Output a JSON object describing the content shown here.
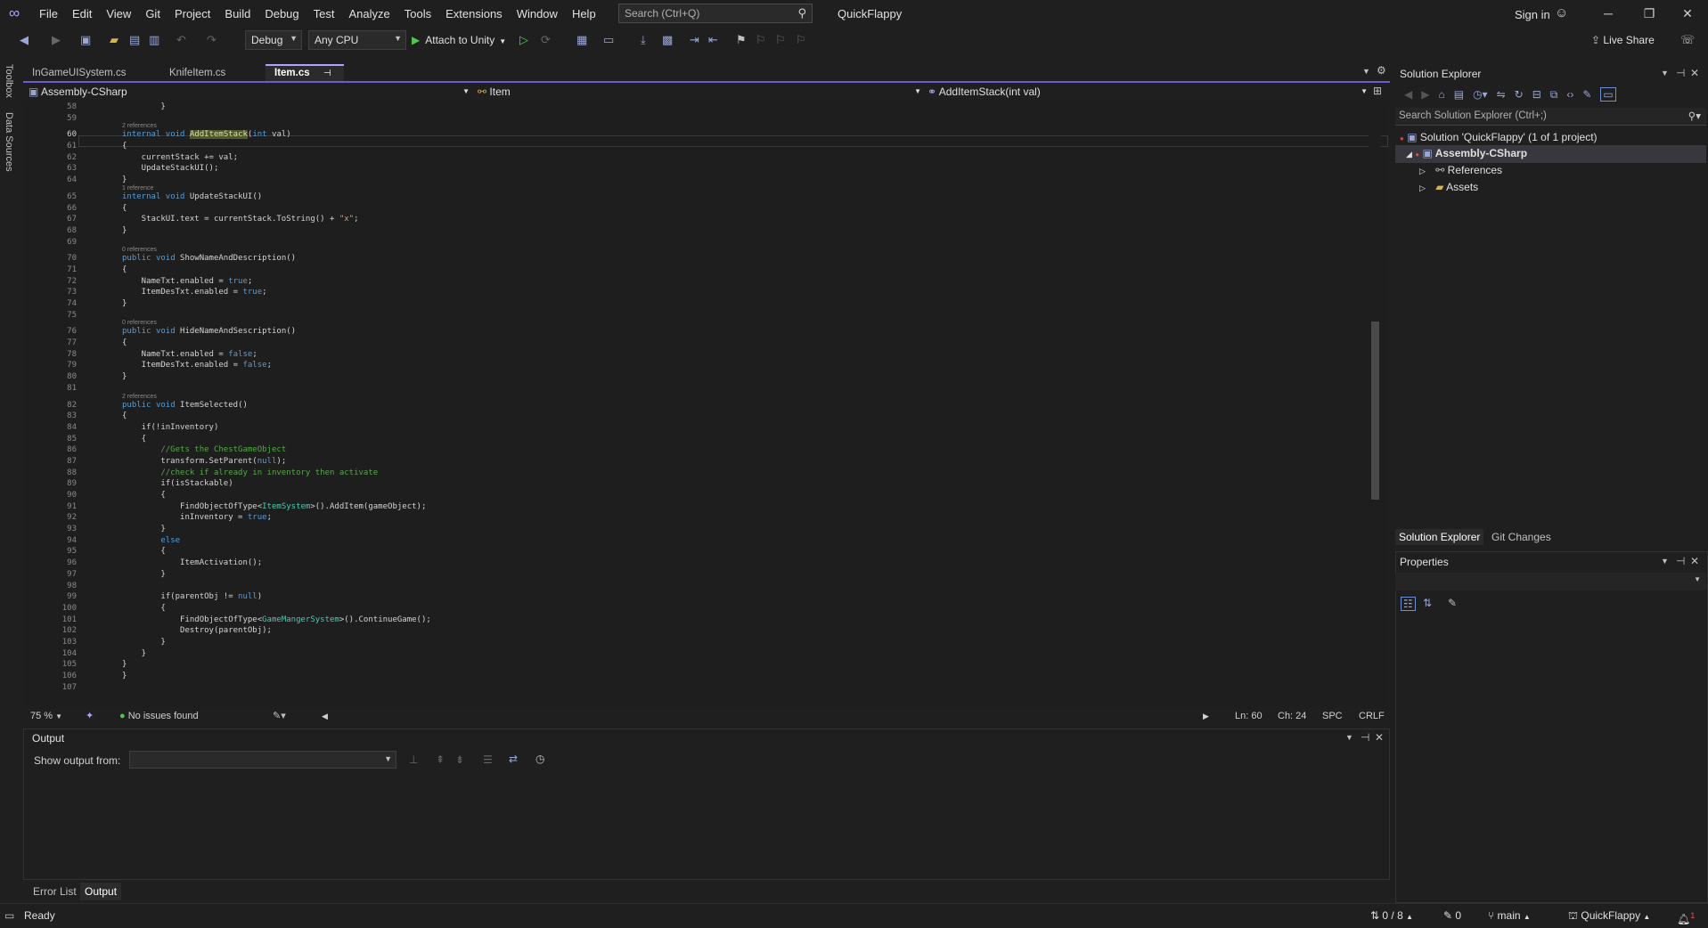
{
  "menu": [
    "File",
    "Edit",
    "View",
    "Git",
    "Project",
    "Build",
    "Debug",
    "Test",
    "Analyze",
    "Tools",
    "Extensions",
    "Window",
    "Help"
  ],
  "search": {
    "placeholder": "Search (Ctrl+Q)"
  },
  "solution_title": "QuickFlappy",
  "account": {
    "sign_in": "Sign in"
  },
  "toolbar": {
    "config": "Debug",
    "platform": "Any CPU",
    "attach": "Attach to Unity",
    "live_share": "Live Share"
  },
  "left_strip": [
    "Toolbox",
    "Data Sources"
  ],
  "tabs": [
    {
      "label": "InGameUISystem.cs"
    },
    {
      "label": "KnifeItem.cs"
    },
    {
      "label": "Item.cs"
    }
  ],
  "navbar": {
    "project": "Assembly-CSharp",
    "type": "Item",
    "member": "AddItemStack(int val)"
  },
  "editor": {
    "lines": [
      {
        "n": "58",
        "code": "        }"
      },
      {
        "n": "59",
        "code": ""
      },
      {
        "n": "60",
        "ref": "2 references",
        "code": "internal void AddItemStack(int val)"
      },
      {
        "n": "61",
        "code": "{"
      },
      {
        "n": "62",
        "code": "    currentStack += val;"
      },
      {
        "n": "63",
        "code": "    UpdateStackUI();"
      },
      {
        "n": "64",
        "code": "}"
      },
      {
        "n": "65",
        "ref": "1 reference",
        "code": "internal void UpdateStackUI()"
      },
      {
        "n": "66",
        "code": "{"
      },
      {
        "n": "67",
        "code": "    StackUI.text = currentStack.ToString() + \"x\";"
      },
      {
        "n": "68",
        "code": "}"
      },
      {
        "n": "69",
        "code": ""
      },
      {
        "n": "70",
        "ref": "0 references",
        "code": "public void ShowNameAndDescription()"
      },
      {
        "n": "71",
        "code": "{"
      },
      {
        "n": "72",
        "code": "    NameTxt.enabled = true;"
      },
      {
        "n": "73",
        "code": "    ItemDesTxt.enabled = true;"
      },
      {
        "n": "74",
        "code": "}"
      },
      {
        "n": "75",
        "code": ""
      },
      {
        "n": "76",
        "ref": "0 references",
        "code": "public void HideNameAndSescription()"
      },
      {
        "n": "77",
        "code": "{"
      },
      {
        "n": "78",
        "code": "    NameTxt.enabled = false;"
      },
      {
        "n": "79",
        "code": "    ItemDesTxt.enabled = false;"
      },
      {
        "n": "80",
        "code": "}"
      },
      {
        "n": "81",
        "code": ""
      },
      {
        "n": "82",
        "ref": "2 references",
        "code": "public void ItemSelected()"
      },
      {
        "n": "83",
        "code": "{"
      },
      {
        "n": "84",
        "code": "    if(!inInventory)"
      },
      {
        "n": "85",
        "code": "    {"
      },
      {
        "n": "86",
        "code": "        //Gets the ChestGameObject"
      },
      {
        "n": "87",
        "code": "        transform.SetParent(null);"
      },
      {
        "n": "88",
        "code": "        //check if already in inventory then activate"
      },
      {
        "n": "89",
        "code": "        if(isStackable)"
      },
      {
        "n": "90",
        "code": "        {"
      },
      {
        "n": "91",
        "code": "            FindObjectOfType<ItemSystem>().AddItem(gameObject);"
      },
      {
        "n": "92",
        "code": "            inInventory = true;"
      },
      {
        "n": "93",
        "code": "        }"
      },
      {
        "n": "94",
        "code": "        else"
      },
      {
        "n": "95",
        "code": "        {"
      },
      {
        "n": "96",
        "code": "            ItemActivation();"
      },
      {
        "n": "97",
        "code": "        }"
      },
      {
        "n": "98",
        "code": ""
      },
      {
        "n": "99",
        "code": "        if(parentObj != null)"
      },
      {
        "n": "100",
        "code": "        {"
      },
      {
        "n": "101",
        "code": "            FindObjectOfType<GameMangerSystem>().ContinueGame();"
      },
      {
        "n": "102",
        "code": "            Destroy(parentObj);"
      },
      {
        "n": "103",
        "code": "        }"
      },
      {
        "n": "104",
        "code": "    }"
      },
      {
        "n": "105",
        "code": "}"
      },
      {
        "n": "106",
        "code": "}"
      },
      {
        "n": "107",
        "code": ""
      }
    ]
  },
  "editor_status": {
    "zoom": "75 %",
    "issues": "No issues found",
    "ln": "Ln: 60",
    "ch": "Ch: 24",
    "spc": "SPC",
    "eol": "CRLF"
  },
  "output": {
    "title": "Output",
    "show_from": "Show output from:"
  },
  "bottom_tabs": [
    "Error List",
    "Output"
  ],
  "solution_explorer": {
    "title": "Solution Explorer",
    "search_placeholder": "Search Solution Explorer (Ctrl+;)",
    "solution": "Solution 'QuickFlappy' (1 of 1 project)",
    "project": "Assembly-CSharp",
    "children": [
      "References",
      "Assets"
    ],
    "tabs": [
      "Solution Explorer",
      "Git Changes"
    ]
  },
  "properties": {
    "title": "Properties"
  },
  "statusbar": {
    "ready": "Ready",
    "updown": "0 / 8",
    "edits": "0",
    "branch": "main",
    "repo": "QuickFlappy",
    "notif_count": "1"
  },
  "colors": {
    "accent": "#b4a0ff",
    "background": "#1f1f1f",
    "editor_bg": "#1e1e1e",
    "keyword": "#569cd6",
    "type": "#4ec9b0",
    "comment": "#57a64a",
    "ok_green": "#4ec94e"
  }
}
